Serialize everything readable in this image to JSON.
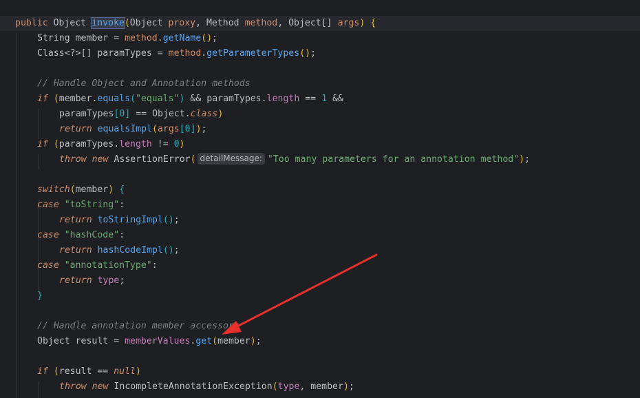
{
  "code": {
    "l01": {
      "public": "public",
      "object": "Object",
      "method_name": "invoke",
      "open_paren": "(",
      "param_type1": "Object",
      "proxy": "proxy",
      "comma1": ", ",
      "param_type2": "Method",
      "method": "method",
      "comma2": ", ",
      "param_type3": "Object[]",
      "args": "args",
      "close_paren": ")",
      "brace": "{"
    },
    "l02": {
      "type": "String",
      "var": "member",
      "eq": "=",
      "recv": "method",
      "dot": ".",
      "call": "getName",
      "parens": "()",
      "semi": ";"
    },
    "l03": {
      "type": "Class<?>[]",
      "var": "paramTypes",
      "eq": "=",
      "recv": "method",
      "dot": ".",
      "call": "getParameterTypes",
      "parens": "()",
      "semi": ";"
    },
    "l05": {
      "comment": "// Handle Object and Annotation methods"
    },
    "l06": {
      "if": "if",
      "open": "(",
      "recv": "member",
      "dot": ".",
      "call": "equals",
      "open2": "(",
      "str": "\"equals\"",
      "close2": ")",
      "and": "&&",
      "recv2": "paramTypes",
      "dot2": ".",
      "field": "length",
      "op": "==",
      "num": "1",
      "and2": "&&"
    },
    "l07": {
      "var": "paramTypes",
      "open": "[",
      "num": "0",
      "close": "]",
      "op": "==",
      "type": "Object",
      "dot": ".",
      "kw": "class",
      "close2": ")"
    },
    "l08": {
      "return": "return",
      "call": "equalsImpl",
      "open": "(",
      "recv": "args",
      "open2": "[",
      "num": "0",
      "close2": "]",
      "close": ")",
      "semi": ";"
    },
    "l09": {
      "if": "if",
      "open": "(",
      "recv": "paramTypes",
      "dot": ".",
      "field": "length",
      "op": "!=",
      "num": "0",
      "close": ")"
    },
    "l10": {
      "throw": "throw",
      "new": "new",
      "type": "AssertionError",
      "open": "(",
      "hint": "detailMessage:",
      "str": "\"Too many parameters for an annotation method\"",
      "close": ")",
      "semi": ";"
    },
    "l12": {
      "switch": "switch",
      "open": "(",
      "var": "member",
      "close": ")",
      "brace": "{"
    },
    "l13": {
      "case": "case",
      "str": "\"toString\"",
      "colon": ":"
    },
    "l14": {
      "return": "return",
      "call": "toStringImpl",
      "parens": "()",
      "semi": ";"
    },
    "l15": {
      "case": "case",
      "str": "\"hashCode\"",
      "colon": ":"
    },
    "l16": {
      "return": "return",
      "call": "hashCodeImpl",
      "parens": "()",
      "semi": ";"
    },
    "l17": {
      "case": "case",
      "str": "\"annotationType\"",
      "colon": ":"
    },
    "l18": {
      "return": "return",
      "field": "type",
      "semi": ";"
    },
    "l19": {
      "brace": "}"
    },
    "l21": {
      "comment": "// Handle annotation member accessors"
    },
    "l22": {
      "type": "Object",
      "var": "result",
      "eq": "=",
      "field": "memberValues",
      "dot": ".",
      "call": "get",
      "open": "(",
      "arg": "member",
      "close": ")",
      "semi": ";"
    },
    "l24": {
      "if": "if",
      "open": "(",
      "var": "result",
      "op": "==",
      "null": "null",
      "close": ")"
    },
    "l25": {
      "throw": "throw",
      "new": "new",
      "type": "IncompleteAnnotationException",
      "open": "(",
      "field": "type",
      "comma": ", ",
      "arg": "member",
      "close": ")",
      "semi": ";"
    }
  },
  "colors": {
    "background": "#1e1f22",
    "keyword": "#cf8e6d",
    "function": "#56a8f5",
    "field": "#c77dbb",
    "string": "#6aab73",
    "number": "#2aacb8",
    "comment": "#7a7e85",
    "arrow": "#e5302b"
  }
}
